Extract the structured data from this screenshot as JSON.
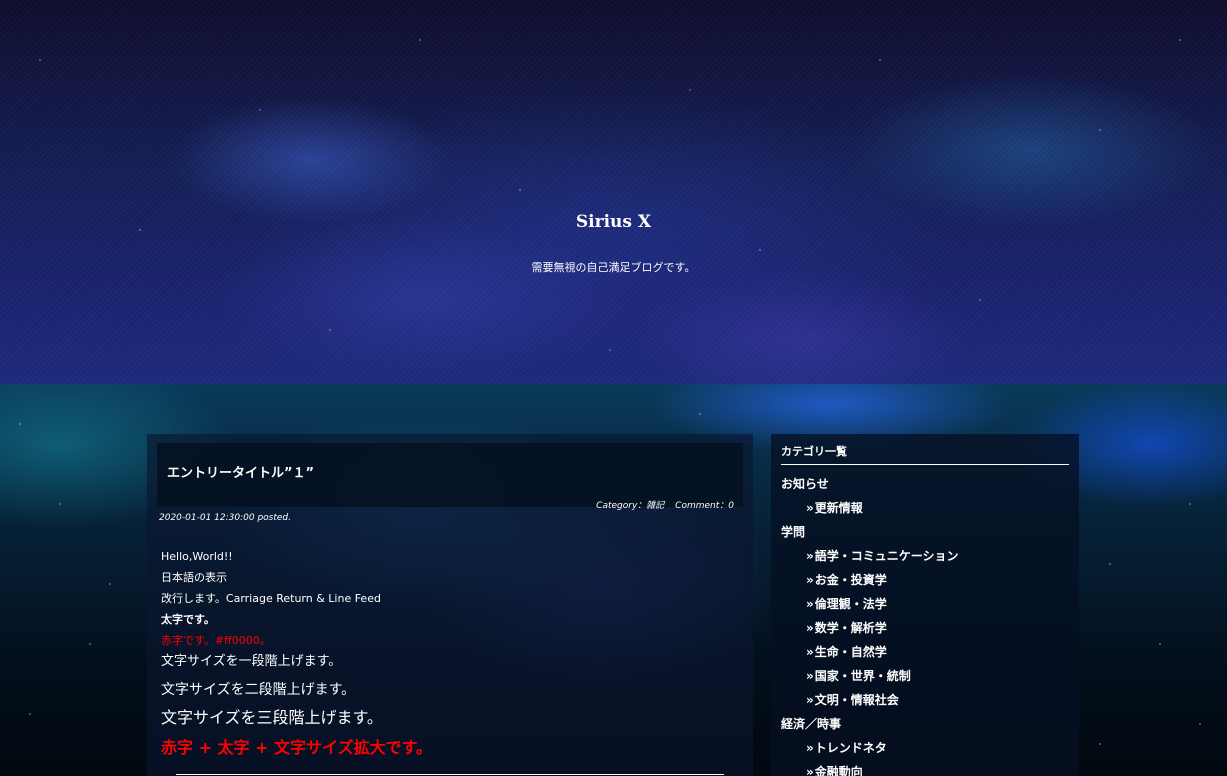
{
  "header": {
    "site_title": "Sirius X",
    "site_description": "需要無視の自己満足ブログです。"
  },
  "entry": {
    "title": "エントリータイトル”１”",
    "category_text": "Category：雑記",
    "comment_text": "Comment：0",
    "posted_text": "2020-01-01 12:30:00 posted.",
    "body_lines": [
      "Hello,World!!",
      "日本語の表示",
      "改行します。Carriage Return & Line Feed",
      "太字です。",
      "赤字です。#ff0000。",
      "文字サイズを一段階上げます。",
      "文字サイズを二段階上げます。",
      "文字サイズを三段階上げます。",
      "赤字 + 太字 + 文字サイズ拡大です。"
    ]
  },
  "sidebar": {
    "title": "カテゴリ一覧",
    "arrow": "»",
    "categories": [
      {
        "label": "お知らせ"
      },
      {
        "label": "更新情報"
      },
      {
        "label": "学問"
      },
      {
        "label": "語学・コミュニケーション"
      },
      {
        "label": "お金・投資学"
      },
      {
        "label": "倫理観・法学"
      },
      {
        "label": "数学・解析学"
      },
      {
        "label": "生命・自然学"
      },
      {
        "label": "国家・世界・統制"
      },
      {
        "label": "文明・情報社会"
      },
      {
        "label": "経済／時事"
      },
      {
        "label": "トレンドネタ"
      },
      {
        "label": "金融動向"
      }
    ]
  },
  "colors": {
    "red_text": "#ff0000",
    "text": "#ffffff"
  }
}
